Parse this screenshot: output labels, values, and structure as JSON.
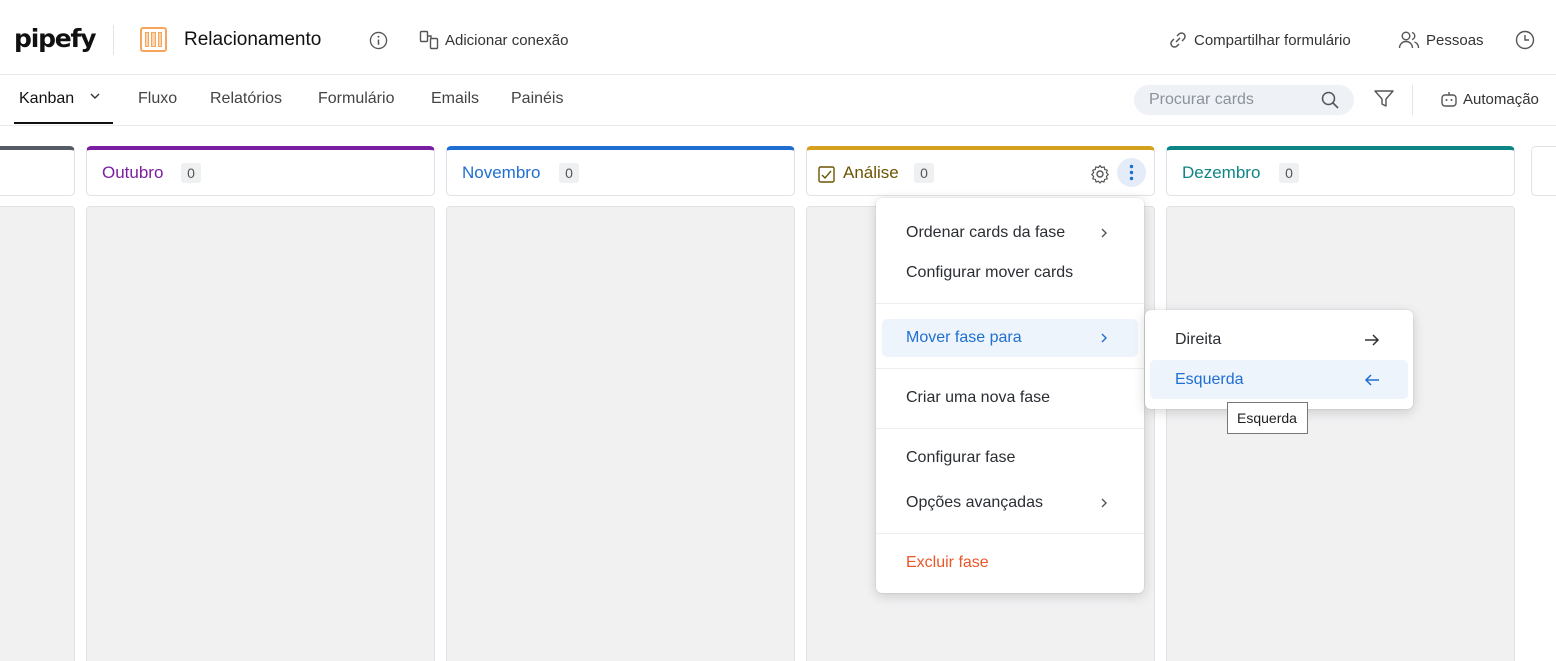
{
  "brand": {
    "logo_text": "pipefy"
  },
  "header": {
    "pipe_title": "Relacionamento",
    "add_connection": "Adicionar conexão",
    "share_form": "Compartilhar formulário",
    "people": "Pessoas"
  },
  "nav": {
    "tabs": [
      {
        "label": "Kanban"
      },
      {
        "label": "Fluxo"
      },
      {
        "label": "Relatórios"
      },
      {
        "label": "Formulário"
      },
      {
        "label": "Emails"
      },
      {
        "label": "Painéis"
      }
    ],
    "search_placeholder": "Procurar cards",
    "automation": "Automação"
  },
  "phases": [
    {
      "name": "Outubro",
      "count": "0",
      "color": "#7b1fa2"
    },
    {
      "name": "Novembro",
      "count": "0",
      "color": "#1f6fd1"
    },
    {
      "name": "Análise",
      "count": "0",
      "color": "#d4a01e",
      "text_color": "#6b5500"
    },
    {
      "name": "Dezembro",
      "count": "0",
      "color": "#0e8585"
    }
  ],
  "phase_menu": {
    "items": [
      {
        "label": "Ordenar cards da fase"
      },
      {
        "label": "Configurar mover cards"
      },
      {
        "label": "Mover fase para"
      },
      {
        "label": "Criar uma nova fase"
      },
      {
        "label": "Configurar fase"
      },
      {
        "label": "Opções avançadas"
      },
      {
        "label": "Excluir fase"
      }
    ],
    "submenu": [
      {
        "label": "Direita"
      },
      {
        "label": "Esquerda"
      }
    ]
  },
  "tooltip": {
    "text": "Esquerda"
  },
  "colors": {
    "accent": "#1f6fd1",
    "danger": "#e8562a",
    "highlight_bg": "#eef4fc"
  }
}
